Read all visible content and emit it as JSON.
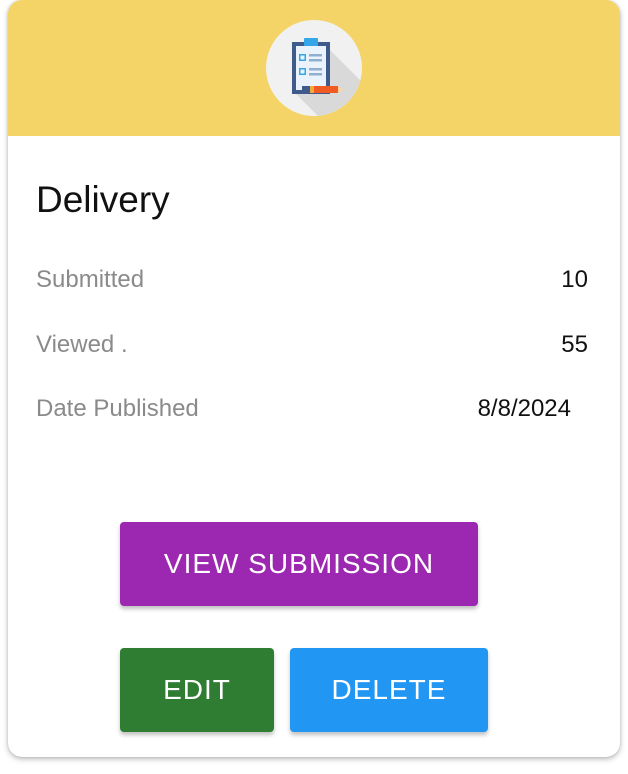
{
  "card": {
    "header_icon": "clipboard-checklist-icon",
    "header_color": "#f4d466",
    "title": "Delivery",
    "stats": {
      "submitted_label": "Submitted",
      "submitted_value": "10",
      "viewed_label": "Viewed .",
      "viewed_value": "55",
      "published_label": "Date Published",
      "published_value": "8/8/2024"
    },
    "actions": {
      "view_label": "VIEW SUBMISSION",
      "view_color": "#9c27b0",
      "edit_label": "EDIT",
      "edit_color": "#2e7d32",
      "delete_label": "DELETE",
      "delete_color": "#2196f3"
    }
  }
}
